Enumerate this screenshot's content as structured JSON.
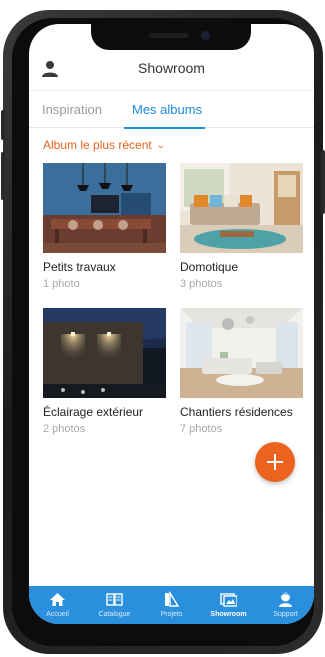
{
  "header": {
    "title": "Showroom",
    "profile_icon": "person-icon"
  },
  "tabs": [
    {
      "label": "Inspiration",
      "active": false
    },
    {
      "label": "Mes albums",
      "active": true
    }
  ],
  "sort": {
    "label": "Album le plus récent",
    "icon": "chevron-down-icon"
  },
  "albums": [
    {
      "name": "Petits travaux",
      "count": "1 photo"
    },
    {
      "name": "Domotique",
      "count": "3 photos"
    },
    {
      "name": "Éclairage extérieur",
      "count": "2 photos"
    },
    {
      "name": "Chantiers résidences",
      "count": "7 photos"
    }
  ],
  "fab": {
    "icon": "plus-icon"
  },
  "bottom_nav": [
    {
      "label": "Accueil",
      "icon": "home-icon",
      "active": false
    },
    {
      "label": "Catalogue",
      "icon": "catalogue-icon",
      "active": false
    },
    {
      "label": "Projets",
      "icon": "projects-icon",
      "active": false
    },
    {
      "label": "Showroom",
      "icon": "showroom-icon",
      "active": true
    },
    {
      "label": "Support",
      "icon": "support-icon",
      "active": false
    }
  ],
  "colors": {
    "accent": "#1f8de0",
    "orange": "#ec6320",
    "nav_bg": "#2a8fdc"
  }
}
